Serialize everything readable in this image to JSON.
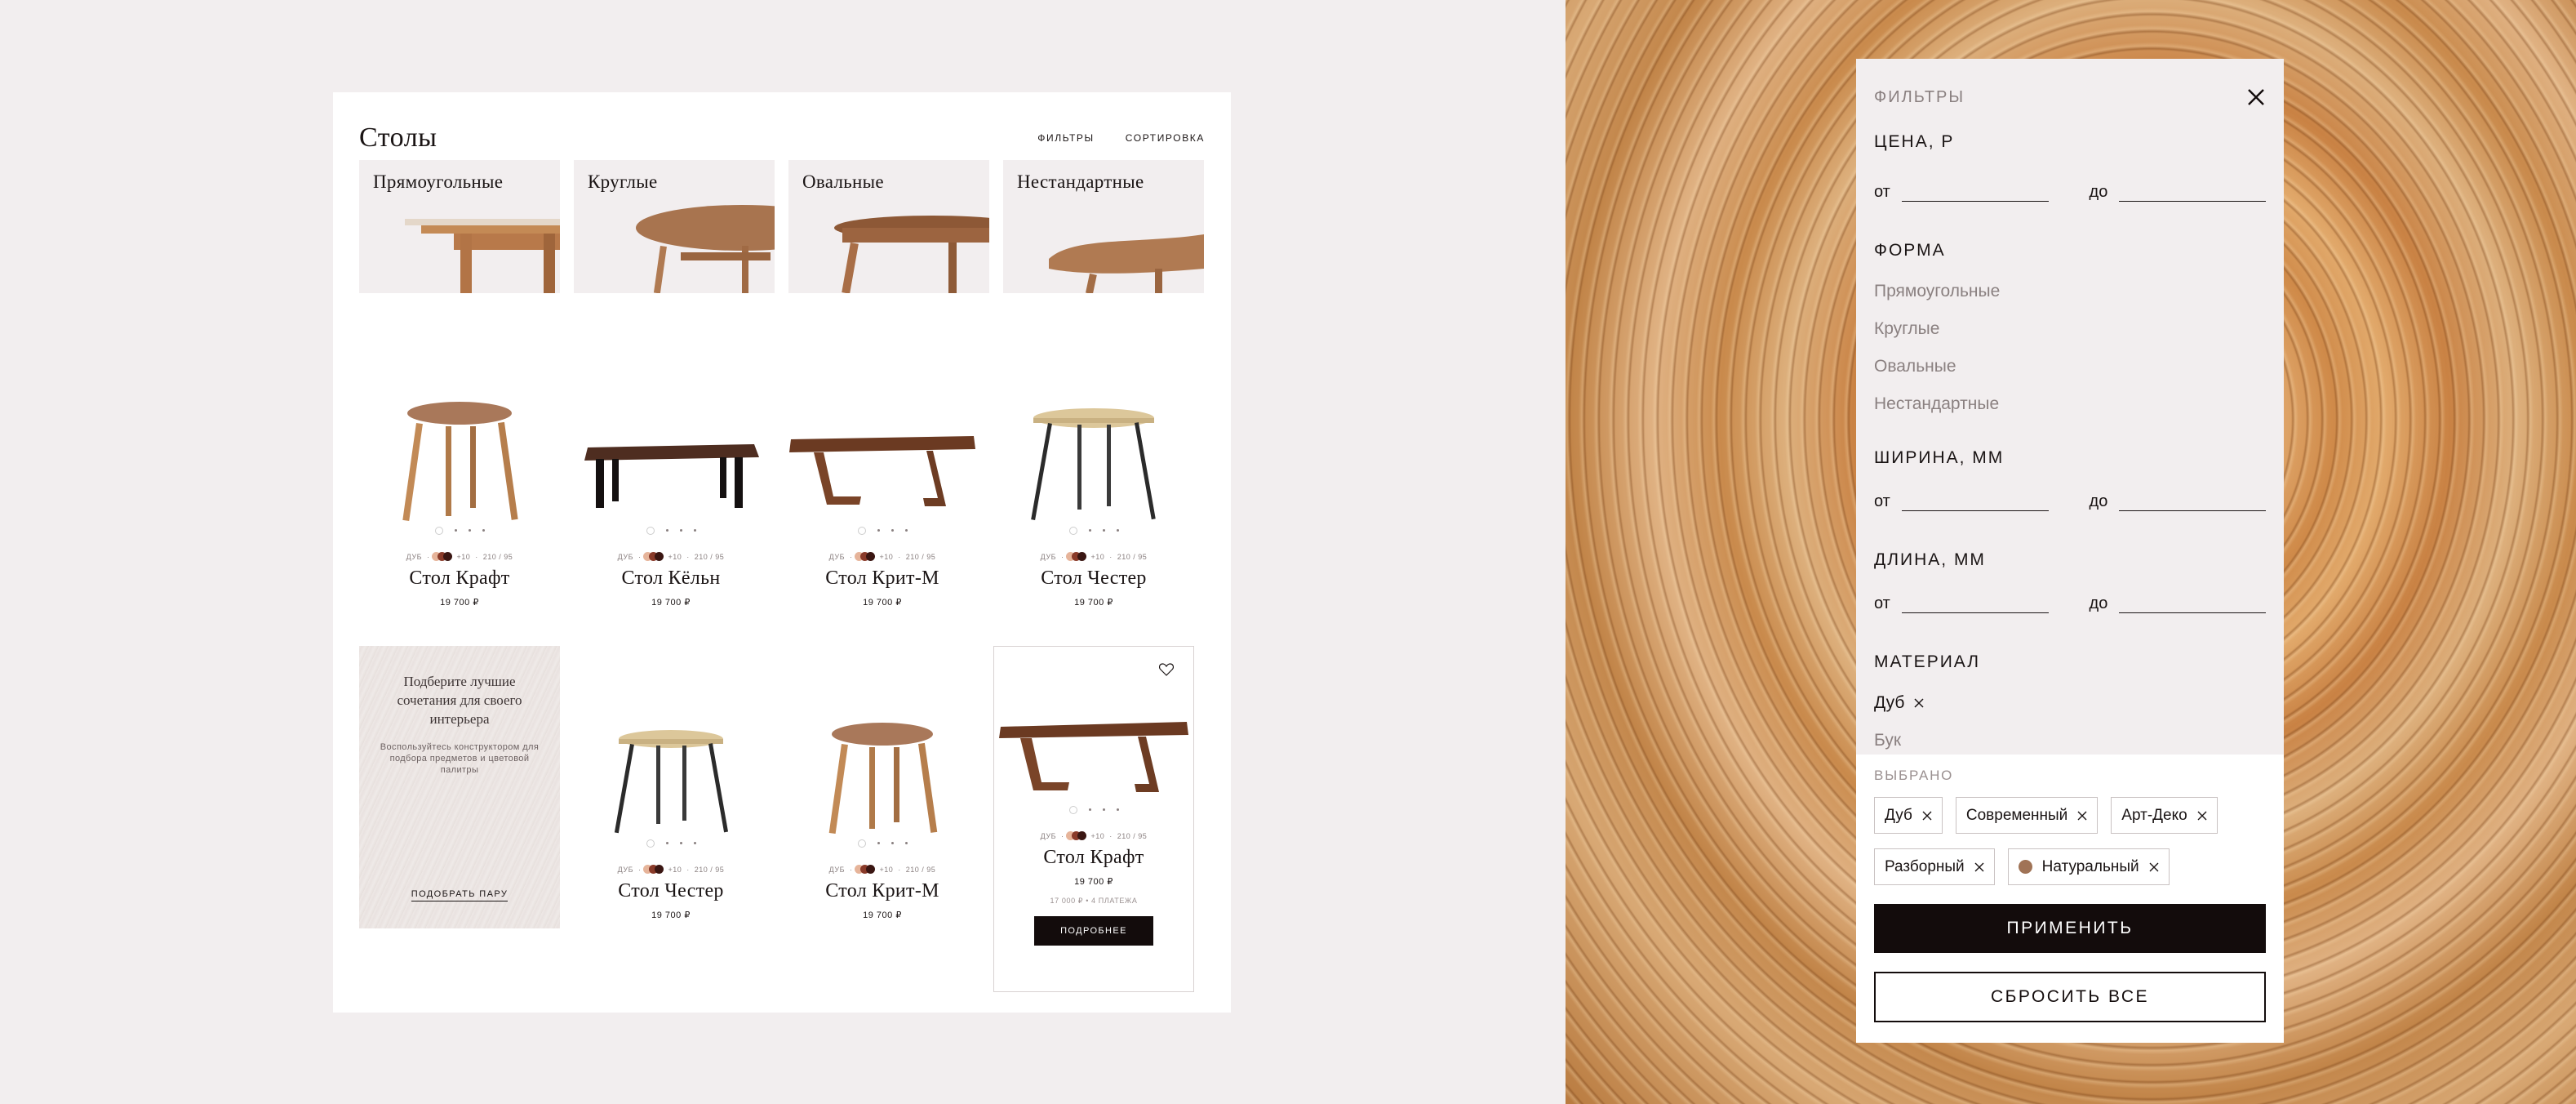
{
  "catalog": {
    "title": "Столы",
    "filters_label": "ФИЛЬТРЫ",
    "sort_label": "СОРТИРОВКА",
    "categories": [
      "Прямоугольные",
      "Круглые",
      "Овальные",
      "Нестандартные"
    ],
    "products_row1": [
      {
        "name": "Стол Крафт",
        "price": "19 700 ₽",
        "material": "ДУБ",
        "colors_more": "+10",
        "size": "210 / 95"
      },
      {
        "name": "Стол Кёльн",
        "price": "19 700 ₽",
        "material": "ДУБ",
        "colors_more": "+10",
        "size": "210 / 95"
      },
      {
        "name": "Стол Крит-М",
        "price": "19 700 ₽",
        "material": "ДУБ",
        "colors_more": "+10",
        "size": "210 / 95"
      },
      {
        "name": "Стол Честер",
        "price": "19 700 ₽",
        "material": "ДУБ",
        "colors_more": "+10",
        "size": "210 / 95"
      }
    ],
    "promo": {
      "heading": "Подберите лучшие сочетания для своего интерьера",
      "text": "Воспользуйтесь конструктором для подбора предметов и цветовой палитры",
      "button": "ПОДОБРАТЬ ПАРУ"
    },
    "products_row2": [
      {
        "name": "Стол Честер",
        "price": "19 700 ₽",
        "material": "ДУБ",
        "colors_more": "+10",
        "size": "210 / 95"
      },
      {
        "name": "Стол Крит-М",
        "price": "19 700 ₽",
        "material": "ДУБ",
        "colors_more": "+10",
        "size": "210 / 95"
      },
      {
        "name": "Стол Крафт",
        "price": "19 700 ₽",
        "material": "ДУБ",
        "colors_more": "+10",
        "size": "210 / 95",
        "installment": "17 000 ₽ • 4 ПЛАТЕЖА",
        "more": "ПОДРОБНЕЕ"
      }
    ],
    "swatch_colors": [
      "#e6b49a",
      "#8a3b2a",
      "#3a1612"
    ]
  },
  "filters": {
    "title": "ФИЛЬТРЫ",
    "price": {
      "label": "ЦЕНА, Р",
      "from": "от",
      "to": "до"
    },
    "shape": {
      "label": "ФОРМА",
      "options": [
        "Прямоугольные",
        "Круглые",
        "Овальные",
        "Нестандартные"
      ]
    },
    "width": {
      "label": "ШИРИНА, ММ",
      "from": "от",
      "to": "до"
    },
    "length": {
      "label": "ДЛИНА, ММ",
      "from": "от",
      "to": "до"
    },
    "material": {
      "label": "МАТЕРИАЛ",
      "selected": "Дуб",
      "other": "Бук"
    },
    "chosen_label": "ВЫБРАНО",
    "chips": [
      "Дуб",
      "Современный",
      "Арт-Деко",
      "Разборный",
      "Натуральный"
    ],
    "apply": "ПРИМЕНИТЬ",
    "reset": "СБРОСИТЬ ВСЕ"
  }
}
